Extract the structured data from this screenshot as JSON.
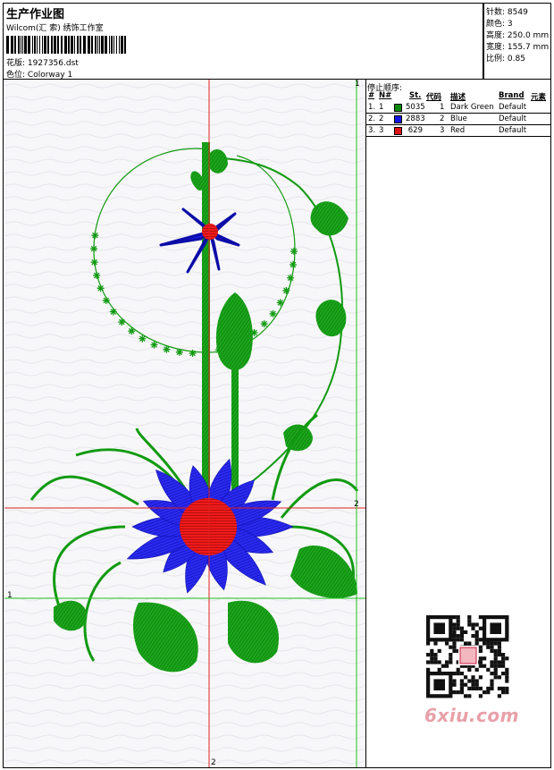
{
  "header": {
    "title": "生产作业图",
    "company": "Wilcom(汇 索) 绣饰工作室",
    "design_label": "花版:",
    "design_value": "1927356.dst",
    "colorway_label": "色位:",
    "colorway_value": "Colorway 1"
  },
  "stats": [
    {
      "label": "针数:",
      "value": "8549"
    },
    {
      "label": "颜色:",
      "value": "3"
    },
    {
      "label": "高度:",
      "value": "250.0 mm"
    },
    {
      "label": "宽度:",
      "value": "155.7 mm"
    },
    {
      "label": "比例:",
      "value": "0.85"
    }
  ],
  "stop_sequence": {
    "title": "停止顺序:",
    "columns": [
      "#",
      "N#",
      "St.",
      "代码",
      "描述",
      "Brand",
      "元素"
    ],
    "rows": [
      {
        "index": "1.",
        "n": "1",
        "stitches": "5035",
        "code": "1",
        "description": "Dark Green",
        "brand": "Default",
        "color": "#0a8a0a"
      },
      {
        "index": "2.",
        "n": "2",
        "stitches": "2883",
        "code": "2",
        "description": "Blue",
        "brand": "Default",
        "color": "#1414e0"
      },
      {
        "index": "3.",
        "n": "3",
        "stitches": "629",
        "code": "3",
        "description": "Red",
        "brand": "Default",
        "color": "#e01414"
      }
    ]
  },
  "guides": {
    "vertical_red_label": "2",
    "vertical_green_label": "1",
    "horizontal_red_label": "2",
    "horizontal_green_label": "1"
  },
  "watermark": "6xiu.com",
  "colors": {
    "green": "#119a11",
    "blue": "#1c1ce6",
    "red": "#ee1212",
    "guide_red": "#e02020",
    "guide_green": "#20c020"
  }
}
